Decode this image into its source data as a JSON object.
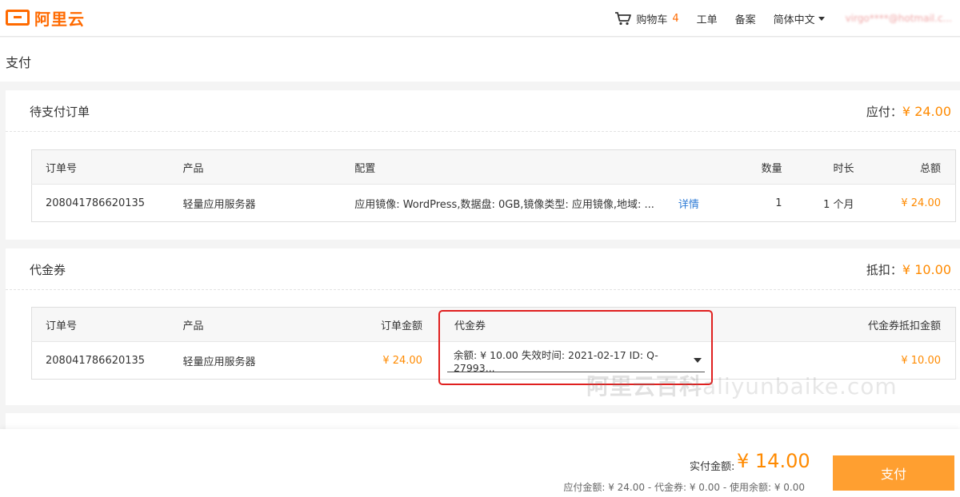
{
  "header": {
    "logo_text": "阿里云",
    "cart_label": "购物车",
    "cart_count": "4",
    "ticket_label": "工单",
    "filing_label": "备案",
    "language_label": "简体中文",
    "user_account": "virgo****@hotmail.c..."
  },
  "page": {
    "title": "支付"
  },
  "pending_orders": {
    "title": "待支付订单",
    "sum_label": "应付：",
    "sum_amount": "¥ 24.00",
    "columns": [
      "订单号",
      "产品",
      "配置",
      "数量",
      "时长",
      "总额"
    ],
    "row": {
      "order_no": "208041786620135",
      "product": "轻量应用服务器",
      "config": "应用镜像: WordPress,数据盘: 0GB,镜像类型: 应用镜像,地域: ...",
      "details_link": "详情",
      "quantity": "1",
      "duration": "1 个月",
      "total": "¥ 24.00"
    }
  },
  "vouchers": {
    "title": "代金券",
    "sum_label": "抵扣：",
    "sum_amount": "¥ 10.00",
    "columns": [
      "订单号",
      "产品",
      "订单金额",
      "代金券",
      "代金券抵扣金额"
    ],
    "row": {
      "order_no": "208041786620135",
      "product": "轻量应用服务器",
      "order_amount": "¥ 24.00",
      "voucher_selected": "余额: ¥ 10.00 失效时间: 2021-02-17 ID: Q-27993...",
      "deduction": "¥ 10.00"
    }
  },
  "watermark": {
    "cn": "阿里云百科",
    "en": "aliyunbaike.com"
  },
  "footer": {
    "pay_label": "实付金额:",
    "pay_amount": "¥ 14.00",
    "breakdown": "应付金额: ¥ 24.00 - 代金券: ¥ 0.00 - 使用余额: ¥ 0.00",
    "pay_button": "支付"
  },
  "colors": {
    "accent": "#ff6a00",
    "amount": "#ff8a00",
    "pay_button": "#ff9f30",
    "link": "#2d7bd6",
    "highlight": "#e0201f"
  }
}
